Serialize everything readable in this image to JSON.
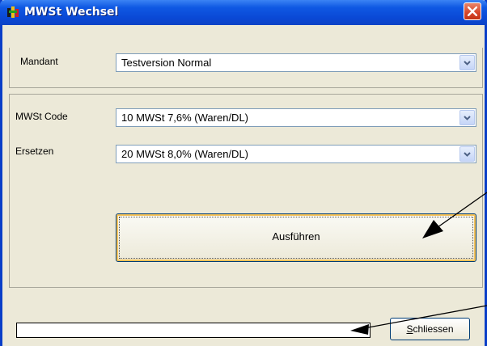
{
  "window": {
    "title": "MWSt Wechsel",
    "icon": "app-icon",
    "close_icon": "close-icon"
  },
  "mandant": {
    "label": "Mandant",
    "value": "Testversion Normal"
  },
  "mwst_code": {
    "label": "MWSt Code",
    "value": "10 MWSt 7,6% (Waren/DL)"
  },
  "ersetzen": {
    "label": "Ersetzen",
    "value": "20 MWSt 8,0% (Waren/DL)"
  },
  "ausfuehren_label": "Ausführen",
  "schliessen_label": "Schliessen",
  "progress_value": 0,
  "colors": {
    "titlebar": "#0a49d6",
    "window_bg": "#ece9d8",
    "close_button": "#d6452a",
    "combo_border": "#7f9db9",
    "focus_ring": "#f6c35a"
  }
}
